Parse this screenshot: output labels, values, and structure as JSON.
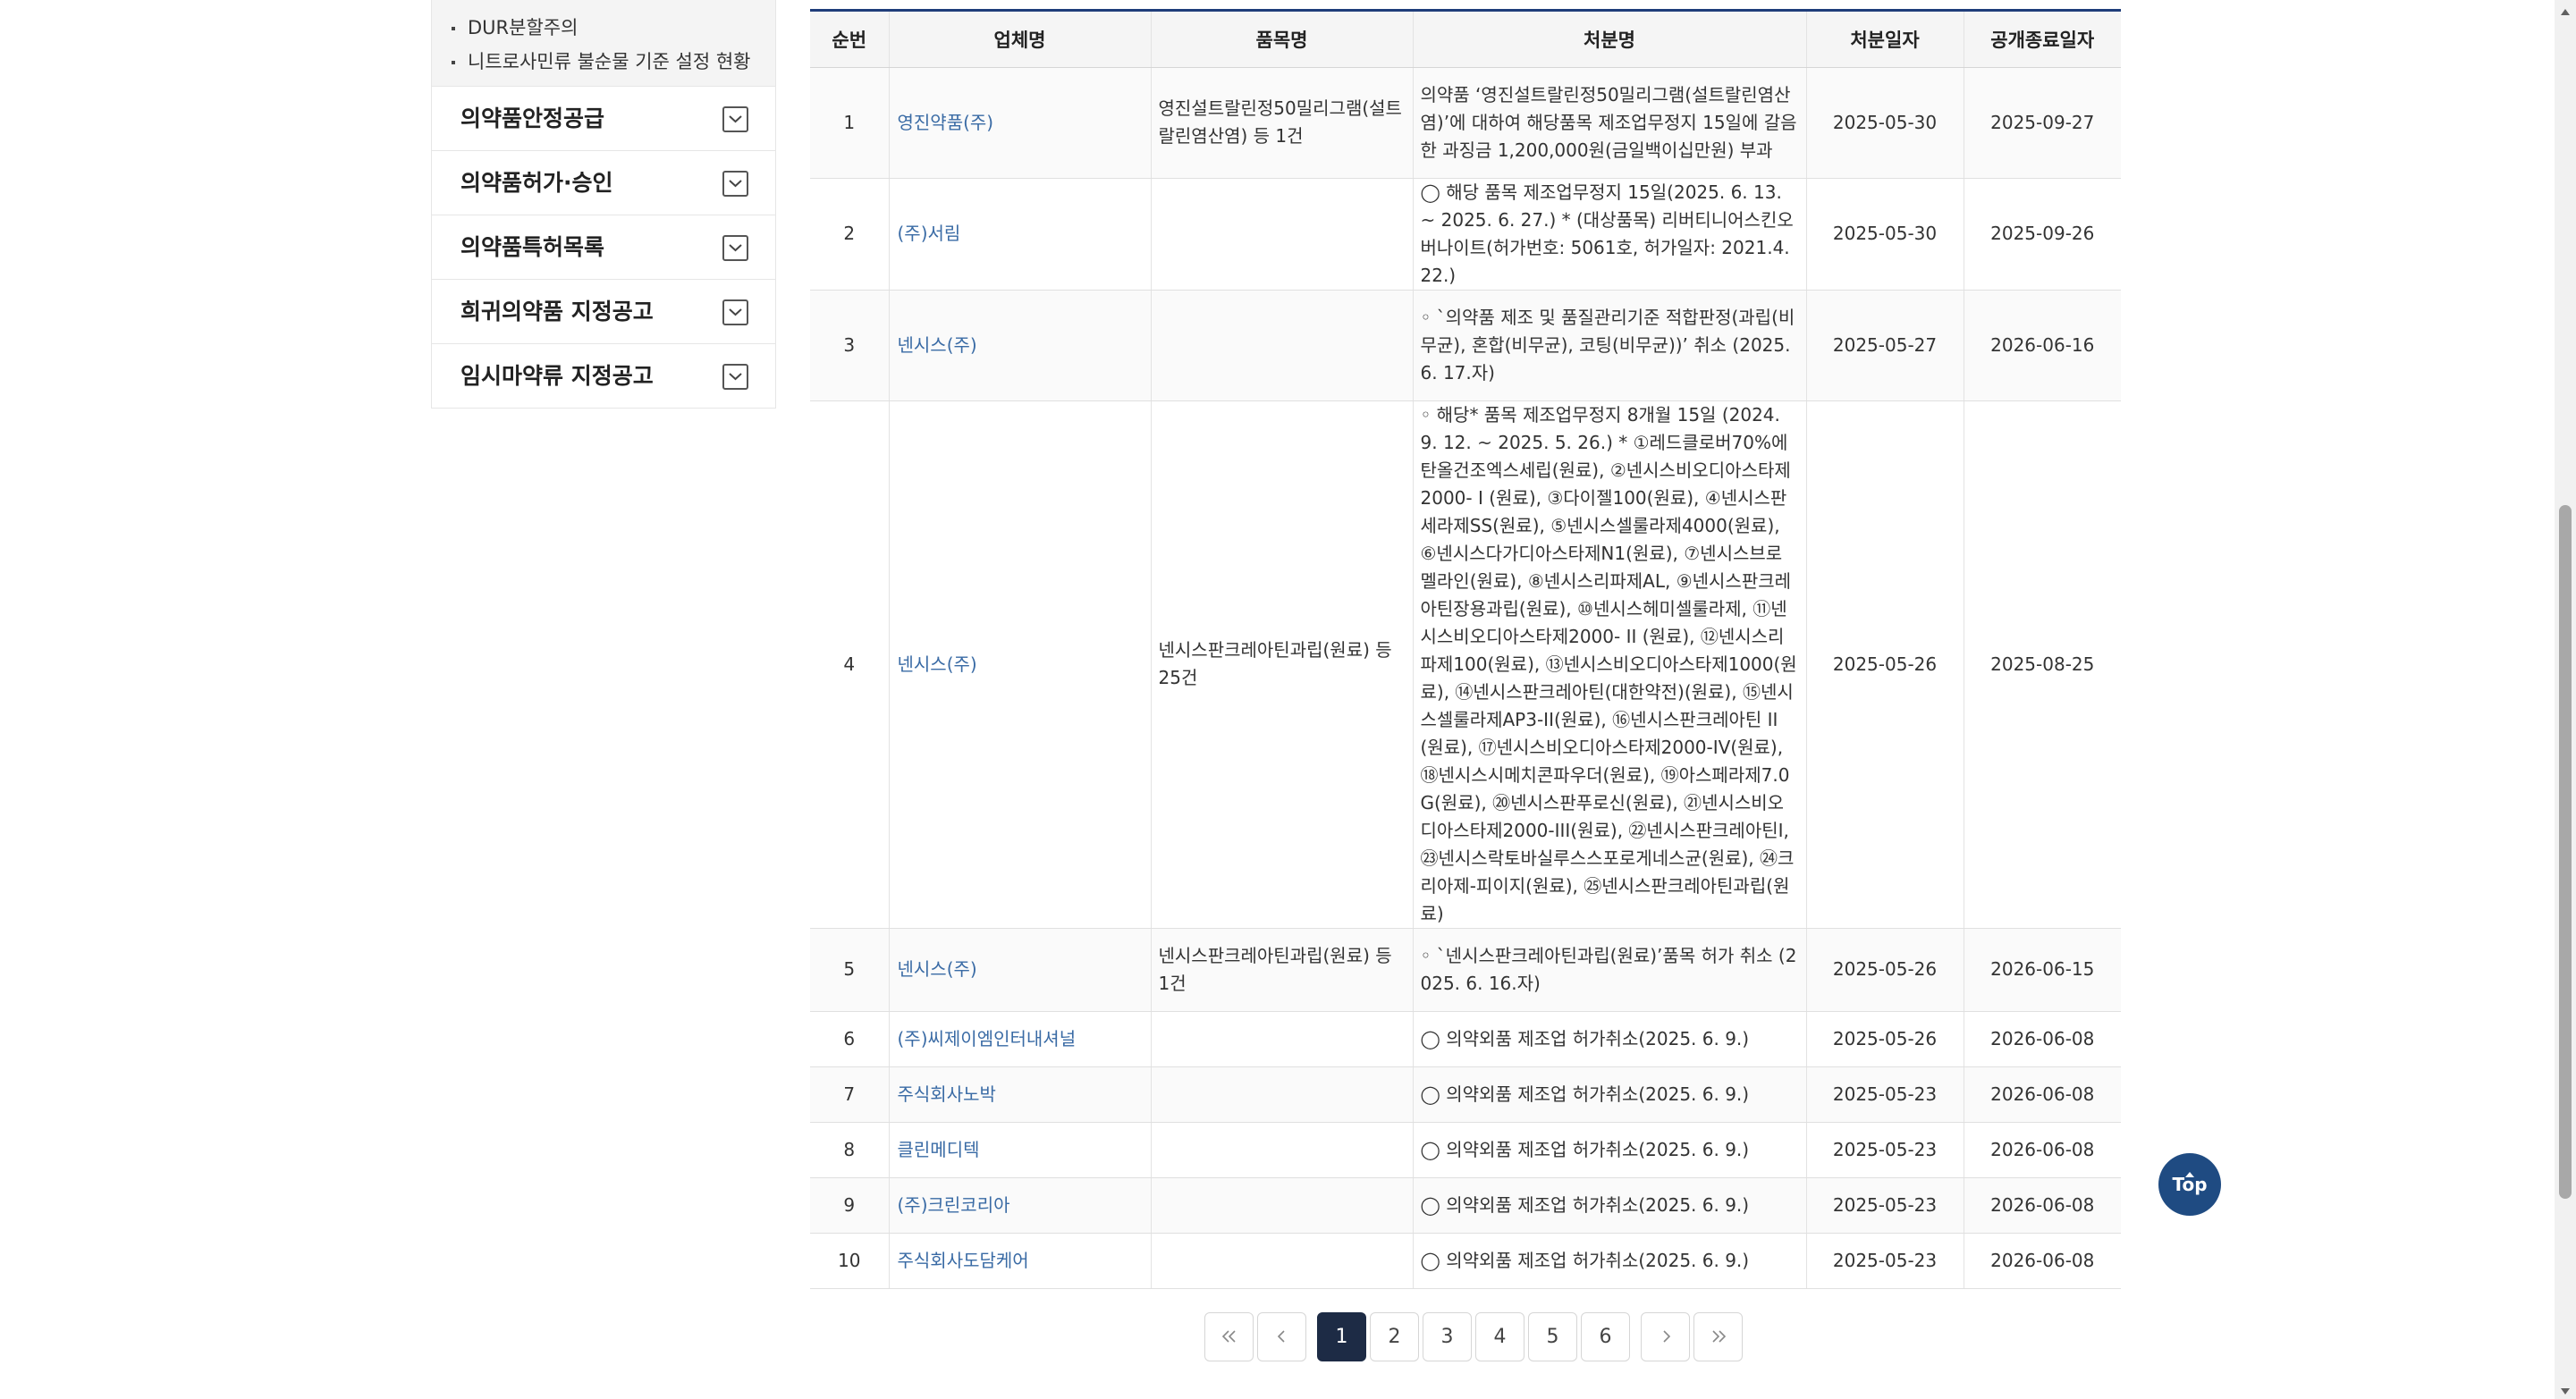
{
  "sidebar": {
    "sub_items": [
      {
        "label": "DUR분할주의"
      },
      {
        "label": "니트로사민류 불순물 기준 설정 현황"
      }
    ],
    "menu_items": [
      {
        "label": "의약품안정공급"
      },
      {
        "label": "의약품허가·승인"
      },
      {
        "label": "의약품특허목록"
      },
      {
        "label": "희귀의약품 지정공고"
      },
      {
        "label": "임시마약류 지정공고"
      }
    ]
  },
  "table": {
    "headers": [
      "순번",
      "업체명",
      "품목명",
      "처분명",
      "처분일자",
      "공개종료일자"
    ],
    "rows": [
      {
        "no": "1",
        "company": "영진약품(주)",
        "product": "영진설트랄린정50밀리그램(설트랄린염산염) 등 1건",
        "action": "의약품 ‘영진설트랄린정50밀리그램(설트랄린염산염)’에 대하여 해당품목 제조업무정지 15일에 갈음한 과징금 1,200,000원(금일백이십만원) 부과",
        "date": "2025-05-30",
        "end": "2025-09-27"
      },
      {
        "no": "2",
        "company": "(주)서림",
        "product": "",
        "action": "◯ 해당 품목 제조업무정지 15일(2025. 6. 13. ~ 2025. 6. 27.) * (대상품목) 리버티니어스킨오버나이트(허가번호: 5061호, 허가일자: 2021.4.22.)",
        "date": "2025-05-30",
        "end": "2025-09-26"
      },
      {
        "no": "3",
        "company": "넨시스(주)",
        "product": "",
        "action": "◦ `의약품 제조 및 품질관리기준 적합판정(과립(비무균), 혼합(비무균), 코팅(비무균))’ 취소 (2025. 6. 17.자)",
        "date": "2025-05-27",
        "end": "2026-06-16"
      },
      {
        "no": "4",
        "company": "넨시스(주)",
        "product": "넨시스판크레아틴과립(원료) 등 25건",
        "action": "◦ 해당* 품목 제조업무정지 8개월 15일 (2024. 9. 12. ~ 2025. 5. 26.) * ①레드클로버70%에탄올건조엑스세립(원료), ②넨시스비오디아스타제2000- I (원료), ③다이젤100(원료), ④넨시스판세라제SS(원료), ⑤넨시스셀룰라제4000(원료), ⑥넨시스다가디아스타제N1(원료), ⑦넨시스브로멜라인(원료), ⑧넨시스리파제AL, ⑨넨시스판크레아틴장용과립(원료), ⑩넨시스헤미셀룰라제, ⑪넨시스비오디아스타제2000- II (원료), ⑫넨시스리파제100(원료), ⑬넨시스비오디아스타제1000(원료), ⑭넨시스판크레아틴(대한약전)(원료), ⑮넨시스셀룰라제AP3-II(원료), ⑯넨시스판크레아틴 II (원료), ⑰넨시스비오디아스타제2000-IV(원료), ⑱넨시스시메치콘파우더(원료), ⑲아스페라제7.0G(원료), ⑳넨시스판푸로신(원료), ㉑넨시스비오디아스타제2000-III(원료), ㉒넨시스판크레아틴I, ㉓넨시스락토바실루스스포로게네스균(원료), ㉔크리아제-피이지(원료), ㉕넨시스판크레아틴과립(원료)",
        "date": "2025-05-26",
        "end": "2025-08-25"
      },
      {
        "no": "5",
        "company": "넨시스(주)",
        "product": "넨시스판크레아틴과립(원료) 등 1건",
        "action": "◦ `넨시스판크레아틴과립(원료)’품목 허가 취소 (2025. 6. 16.자)",
        "date": "2025-05-26",
        "end": "2026-06-15"
      },
      {
        "no": "6",
        "company": "(주)씨제이엠인터내셔널",
        "product": "",
        "action": "◯ 의약외품 제조업 허가취소(2025. 6. 9.)",
        "date": "2025-05-26",
        "end": "2026-06-08"
      },
      {
        "no": "7",
        "company": "주식회사노박",
        "product": "",
        "action": "◯ 의약외품 제조업 허가취소(2025. 6. 9.)",
        "date": "2025-05-23",
        "end": "2026-06-08"
      },
      {
        "no": "8",
        "company": "클린메디텍",
        "product": "",
        "action": "◯ 의약외품 제조업 허가취소(2025. 6. 9.)",
        "date": "2025-05-23",
        "end": "2026-06-08"
      },
      {
        "no": "9",
        "company": "(주)크린코리아",
        "product": "",
        "action": "◯ 의약외품 제조업 허가취소(2025. 6. 9.)",
        "date": "2025-05-23",
        "end": "2026-06-08"
      },
      {
        "no": "10",
        "company": "주식회사도담케어",
        "product": "",
        "action": "◯ 의약외품 제조업 허가취소(2025. 6. 9.)",
        "date": "2025-05-23",
        "end": "2026-06-08"
      }
    ]
  },
  "pagination": {
    "pages": [
      "1",
      "2",
      "3",
      "4",
      "5",
      "6"
    ],
    "current": "1",
    "icons": {
      "first": "double-chevron-left-icon",
      "prev": "chevron-left-icon",
      "next": "chevron-right-icon",
      "last": "double-chevron-right-icon"
    }
  },
  "top_button": {
    "label": "Top"
  },
  "colors": {
    "accent": "#1f3d7a",
    "link": "#3a6ba5",
    "active_page": "#1d2b45",
    "top_button": "#1f4b82"
  }
}
